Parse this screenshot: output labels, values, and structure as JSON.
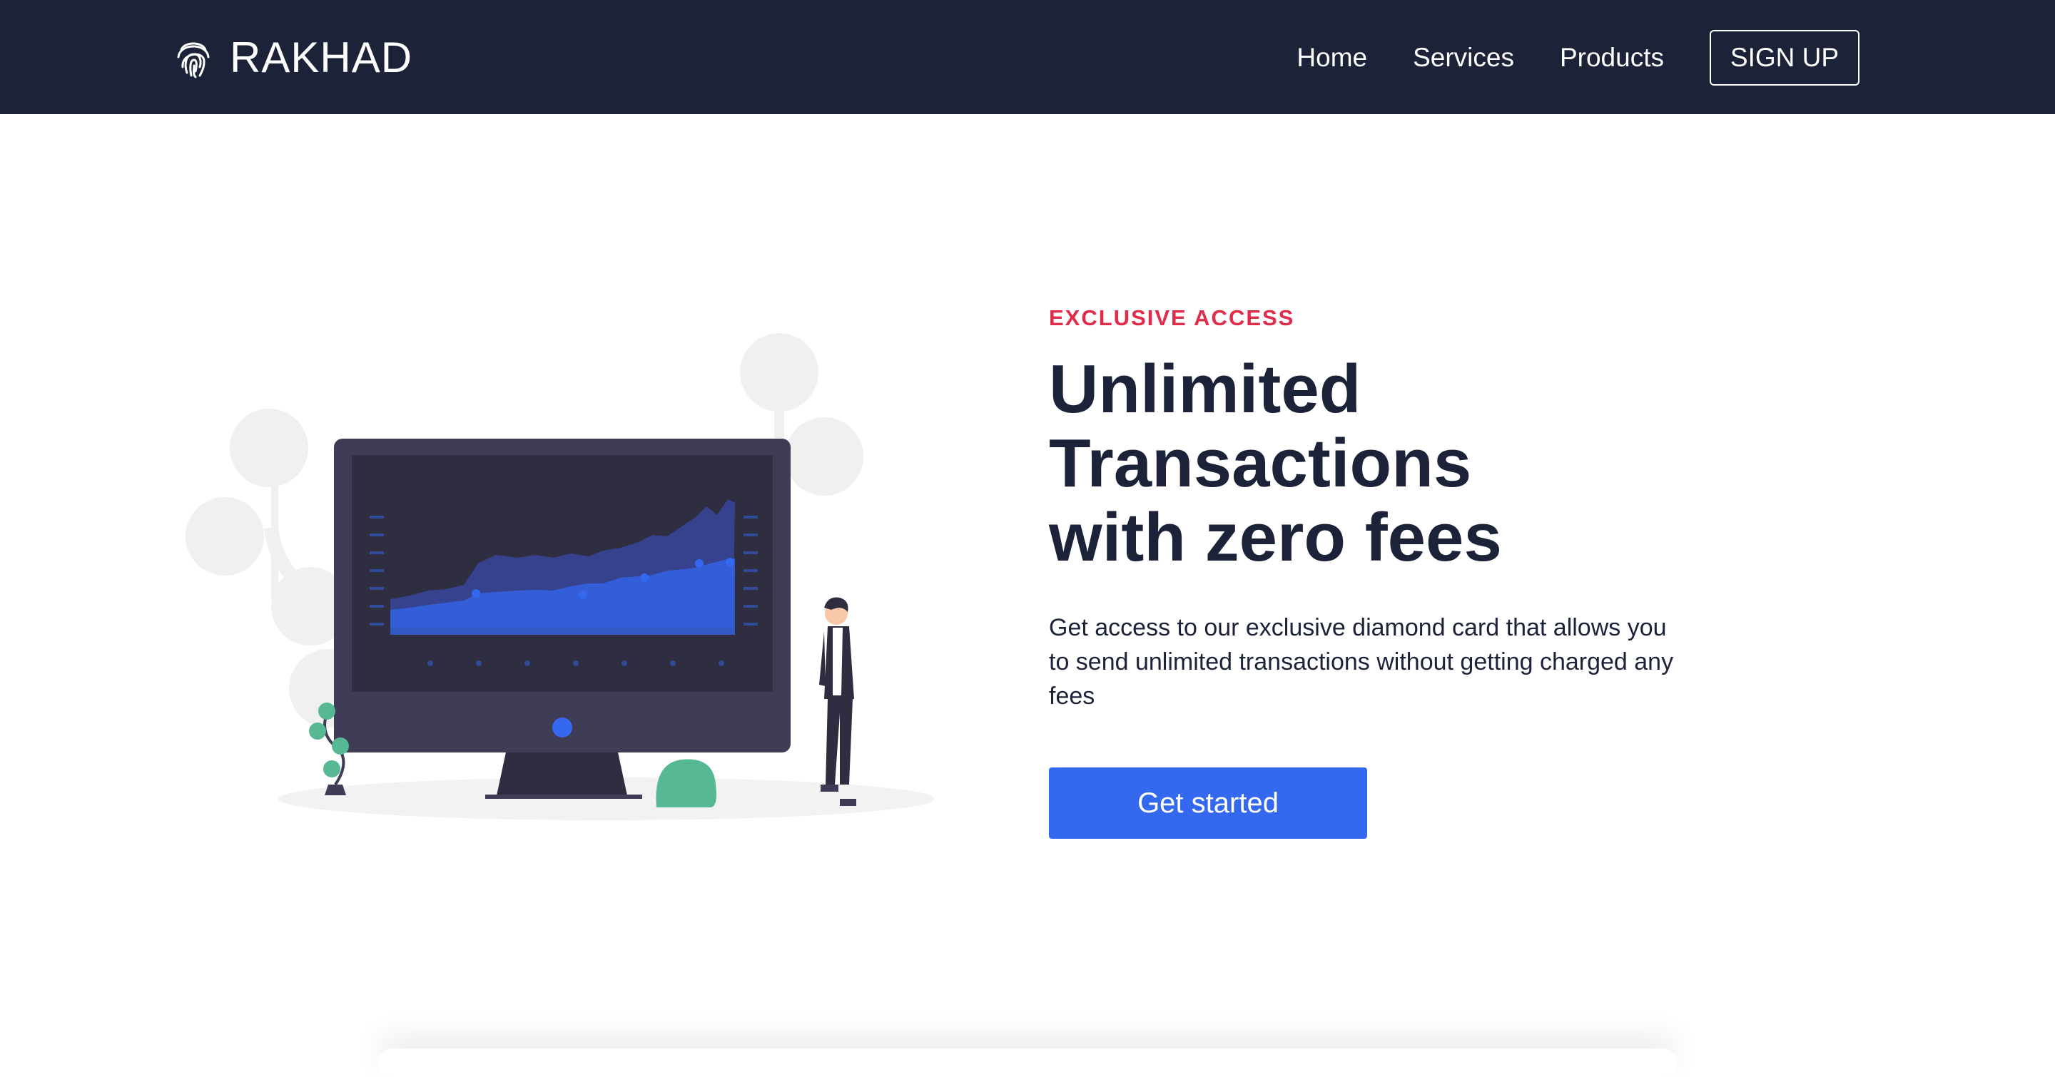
{
  "header": {
    "brand": "RAKHAD",
    "logo_icon": "fingerprint-icon",
    "nav": [
      "Home",
      "Services",
      "Products"
    ],
    "signup_label": "SIGN UP"
  },
  "hero": {
    "eyebrow": "EXCLUSIVE ACCESS",
    "headline_line1": "Unlimited Transactions",
    "headline_line2": "with zero fees",
    "description": "Get access to our exclusive diamond card that allows you to send unlimited transactions without getting charged any fees",
    "cta_label": "Get started",
    "illustration": "person-viewing-chart-on-monitor-illustration"
  },
  "colors": {
    "navbar_bg": "#1c2237",
    "accent_red": "#e02b4a",
    "primary_blue": "#3468ef",
    "text_dark": "#1c2237"
  }
}
